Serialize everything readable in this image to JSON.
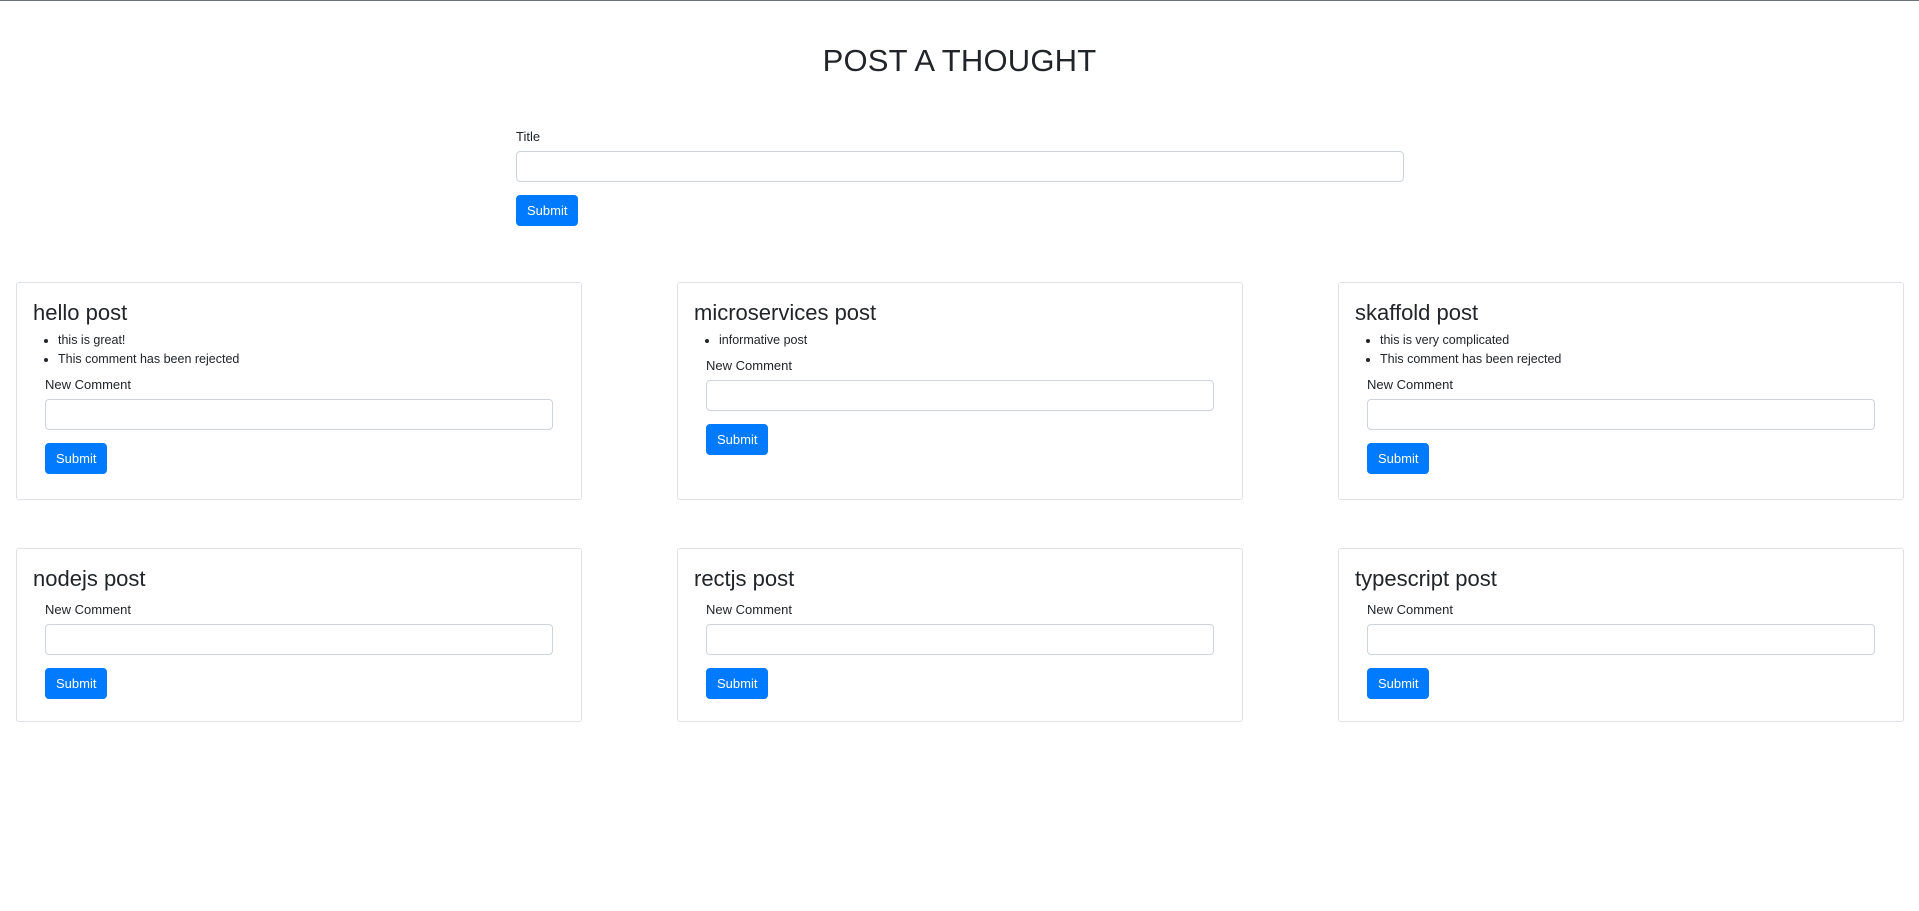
{
  "header": {
    "title": "POST A THOUGHT"
  },
  "create_post": {
    "label": "Title",
    "value": "",
    "placeholder": "",
    "submit_label": "Submit"
  },
  "posts": [
    {
      "title": "hello post",
      "comments": [
        "this is great!",
        "This comment has been rejected"
      ],
      "comment_label": "New Comment",
      "comment_value": "",
      "submit_label": "Submit"
    },
    {
      "title": "microservices post",
      "comments": [
        "informative post"
      ],
      "comment_label": "New Comment",
      "comment_value": "",
      "submit_label": "Submit"
    },
    {
      "title": "skaffold post",
      "comments": [
        "this is very complicated",
        "This comment has been rejected"
      ],
      "comment_label": "New Comment",
      "comment_value": "",
      "submit_label": "Submit"
    },
    {
      "title": "nodejs post",
      "comments": [],
      "comment_label": "New Comment",
      "comment_value": "",
      "submit_label": "Submit"
    },
    {
      "title": "rectjs post",
      "comments": [],
      "comment_label": "New Comment",
      "comment_value": "",
      "submit_label": "Submit"
    },
    {
      "title": "typescript post",
      "comments": [],
      "comment_label": "New Comment",
      "comment_value": "",
      "submit_label": "Submit"
    }
  ],
  "colors": {
    "primary": "#007bff",
    "border": "#dee2e6",
    "text": "#212529"
  }
}
